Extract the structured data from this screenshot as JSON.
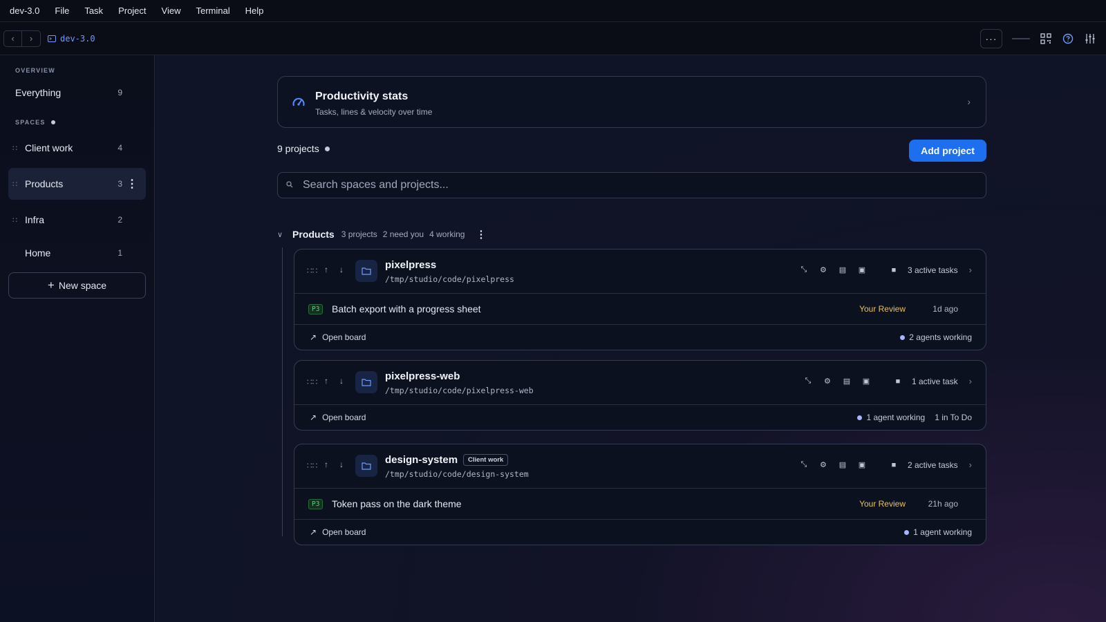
{
  "menubar": {
    "app": "dev-3.0",
    "items": [
      "File",
      "Task",
      "Project",
      "View",
      "Terminal",
      "Help"
    ]
  },
  "toolbar": {
    "breadcrumb": "dev-3.0",
    "more": "···"
  },
  "sidebar": {
    "overview_label": "OVERVIEW",
    "everything": {
      "label": "Everything",
      "count": "9"
    },
    "spaces_label": "SPACES",
    "spaces": [
      {
        "label": "Client work",
        "count": "4"
      },
      {
        "label": "Products",
        "count": "3"
      },
      {
        "label": "Infra",
        "count": "2"
      },
      {
        "label": "Home",
        "count": "1"
      }
    ],
    "new_space": "New space"
  },
  "stats": {
    "title": "Productivity stats",
    "subtitle": "Tasks, lines & velocity over time"
  },
  "projects_count": "9 projects",
  "add_project": "Add project",
  "search": {
    "placeholder": "Search spaces and projects..."
  },
  "group": {
    "name": "Products",
    "projects": "3 projects",
    "need": "2 need you",
    "working": "4 working"
  },
  "projects": [
    {
      "name": "pixelpress",
      "path": "/tmp/studio/code/pixelpress",
      "active": "3 active tasks",
      "task": {
        "priority": "P3",
        "title": "Batch export with a progress sheet",
        "status": "Your Review",
        "ago": "1d ago"
      },
      "open_board": "Open board",
      "agents": "2 agents working"
    },
    {
      "name": "pixelpress-web",
      "path": "/tmp/studio/code/pixelpress-web",
      "active": "1 active task",
      "open_board": "Open board",
      "agents": "1 agent working",
      "todo": "1 in To Do"
    },
    {
      "name": "design-system",
      "tag": "Client work",
      "path": "/tmp/studio/code/design-system",
      "active": "2 active tasks",
      "task": {
        "priority": "P3",
        "title": "Token pass on the dark theme",
        "status": "Your Review",
        "ago": "21h ago"
      },
      "open_board": "Open board",
      "agents": "1 agent working"
    }
  ],
  "colors": {
    "accent": "#1d6ff0",
    "review": "#e8c25a",
    "priority": "#4fd07a"
  }
}
